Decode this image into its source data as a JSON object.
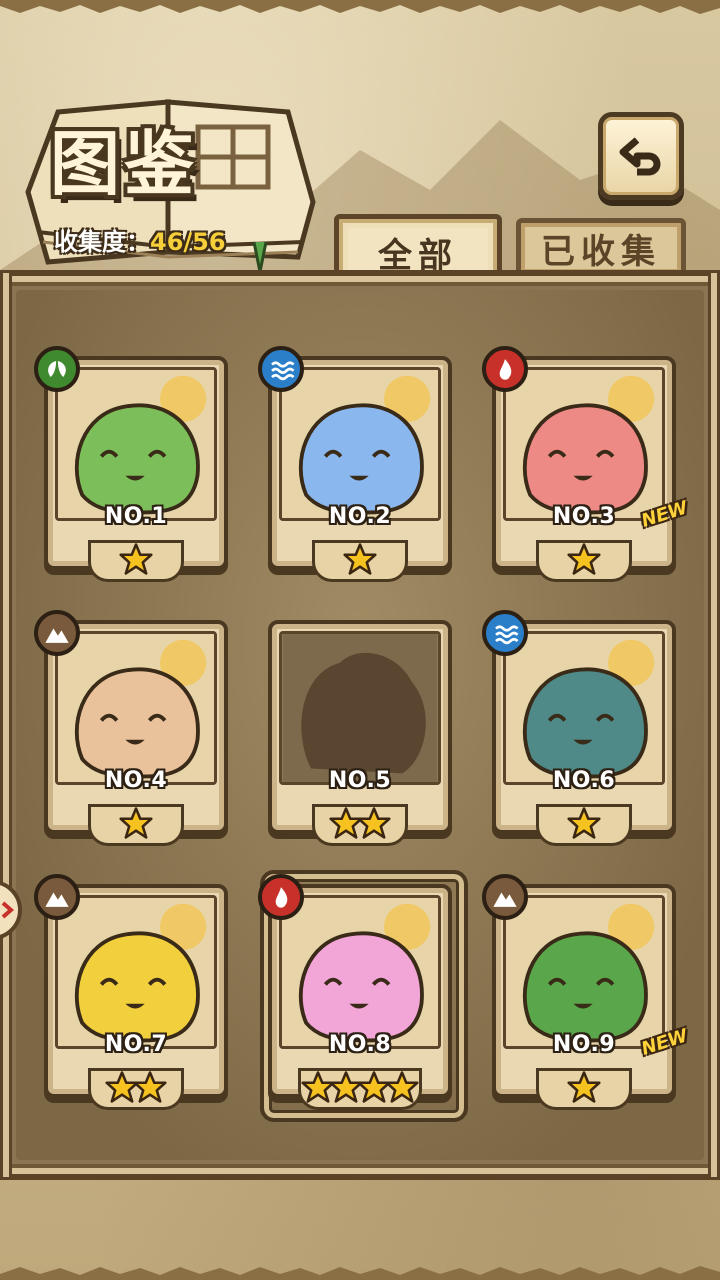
{
  "header": {
    "title": "图鉴",
    "progress_label": "收集度：",
    "progress_value": "46/56"
  },
  "tabs": [
    {
      "label": "全部",
      "active": true
    },
    {
      "label": "已收集",
      "active": false
    }
  ],
  "colors": {
    "grass": "#3f8a2e",
    "water": "#2a7fc8",
    "fire": "#c8302a",
    "earth": "#7a5a3c",
    "star": "#f6c21f",
    "new_badge": "#ffd23a"
  },
  "cards": [
    {
      "label": "NO.1",
      "element": "grass",
      "stars": 1,
      "is_new": false,
      "art_color": "#7cbf5a"
    },
    {
      "label": "NO.2",
      "element": "water",
      "stars": 1,
      "is_new": false,
      "art_color": "#8ab8ee"
    },
    {
      "label": "NO.3",
      "element": "fire",
      "stars": 1,
      "is_new": true,
      "art_color": "#ee8a86"
    },
    {
      "label": "NO.4",
      "element": "earth",
      "stars": 1,
      "is_new": false,
      "art_color": "#e9c29c"
    },
    {
      "label": "NO.5",
      "element": "",
      "stars": 2,
      "is_new": false,
      "art_color": "#5a4630",
      "locked": true
    },
    {
      "label": "NO.6",
      "element": "water",
      "stars": 1,
      "is_new": false,
      "art_color": "#4f8a88"
    },
    {
      "label": "NO.7",
      "element": "earth",
      "stars": 2,
      "is_new": false,
      "art_color": "#f2cf3c"
    },
    {
      "label": "NO.8",
      "element": "fire",
      "stars": 4,
      "is_new": false,
      "art_color": "#f2a6d8",
      "ornate": true
    },
    {
      "label": "NO.9",
      "element": "earth",
      "stars": 1,
      "is_new": true,
      "art_color": "#5aa64a"
    }
  ],
  "new_badge_text": "NEW"
}
